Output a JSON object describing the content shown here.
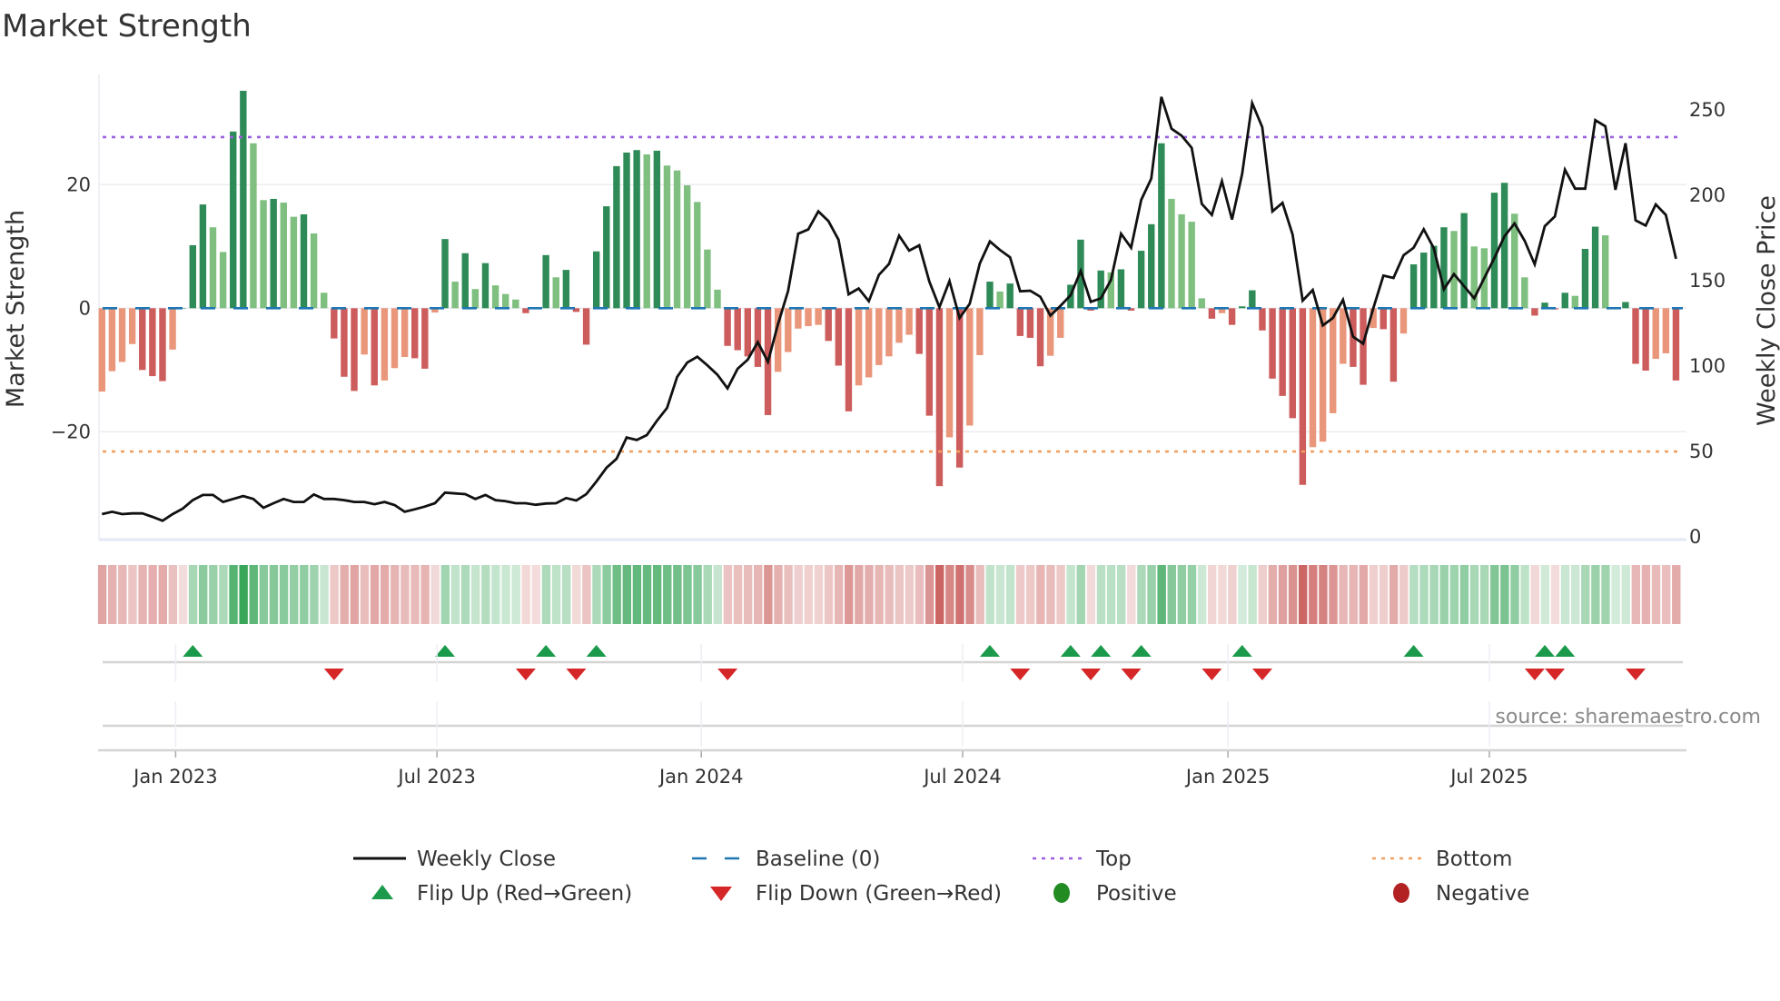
{
  "chart_data": {
    "type": "bar",
    "title": "Market Strength",
    "ylabel": "Market Strength",
    "y2label": "Weekly Close Price",
    "source": "source: sharemaestro.com",
    "ylim": [
      -37.5,
      38.5
    ],
    "y2lim": [
      0,
      260
    ],
    "yticks": [
      {
        "value": -20,
        "label": "−20"
      },
      {
        "value": 0,
        "label": "0"
      },
      {
        "value": 20,
        "label": "20"
      }
    ],
    "y2ticks": [
      {
        "value": 0,
        "label": "0"
      },
      {
        "value": 50,
        "label": "50"
      },
      {
        "value": 100,
        "label": "100"
      },
      {
        "value": 150,
        "label": "150"
      },
      {
        "value": 200,
        "label": "200"
      },
      {
        "value": 250,
        "label": "250"
      }
    ],
    "xticks": [
      {
        "week": 7.3,
        "label": "Jan 2023"
      },
      {
        "week": 33.2,
        "label": "Jul 2023"
      },
      {
        "week": 59.4,
        "label": "Jan 2024"
      },
      {
        "week": 85.3,
        "label": "Jul 2024"
      },
      {
        "week": 111.6,
        "label": "Jan 2025"
      },
      {
        "week": 137.5,
        "label": "Jul 2025"
      }
    ],
    "top_level": 27.7,
    "bottom_level": -23.2,
    "baseline": 0,
    "strength": [
      -13.5,
      -10.2,
      -8.7,
      -5.8,
      -10,
      -11,
      -11.8,
      -6.7,
      0,
      10.2,
      16.8,
      13.1,
      9.1,
      28.6,
      35.2,
      26.7,
      17.5,
      17.7,
      17.1,
      14.8,
      15.2,
      12.1,
      2.5,
      -4.9,
      -11.1,
      -13.4,
      -7.5,
      -12.5,
      -11.7,
      -9.7,
      -7.9,
      -8.1,
      -9.8,
      -0.7,
      11.2,
      4.3,
      8.9,
      3.1,
      7.3,
      3.7,
      2.3,
      1.4,
      -0.8,
      -0.1,
      8.6,
      5.0,
      6.2,
      -0.6,
      -5.9,
      9.2,
      16.5,
      23,
      25.2,
      25.6,
      24.9,
      25.5,
      23.1,
      22.3,
      19.9,
      17.2,
      9.5,
      3,
      -6.1,
      -6.8,
      -7.8,
      -9.5,
      -17.3,
      -10.3,
      -7.1,
      -3.3,
      -2.9,
      -2.7,
      -5.3,
      -9.3,
      -16.7,
      -12.5,
      -11.2,
      -9.2,
      -7.8,
      -5.6,
      -4.3,
      -7.4,
      -17.4,
      -28.8,
      -20.9,
      -25.8,
      -19,
      -7.6,
      4.3,
      2.7,
      4,
      -4.5,
      -4.8,
      -9.4,
      -7.7,
      -4.8,
      3.8,
      11.1,
      -0.4,
      6.1,
      5.8,
      6.3,
      -0.4,
      9.3,
      13.6,
      26.7,
      17.7,
      15.2,
      14,
      1.6,
      -1.7,
      -0.8,
      -2.7,
      0.3,
      2.9,
      -3.6,
      -11.4,
      -14.2,
      -17.8,
      -28.6,
      -22.5,
      -21.6,
      -17,
      -9,
      -9.5,
      -12.4,
      -3.2,
      -3.4,
      -11.9,
      -4.1,
      7.1,
      9,
      10.1,
      13.1,
      12.5,
      15.4,
      10,
      9.7,
      18.7,
      20.3,
      15.3,
      5,
      -1.2,
      0.9,
      -0.2,
      2.5,
      2,
      9.6,
      13.2,
      11.8,
      0.2,
      1,
      -9,
      -10.1,
      -8.2,
      -7.3,
      -11.7
    ],
    "weekly_close": [
      13.3,
      14.7,
      13.3,
      13.7,
      13.8,
      11.7,
      9.4,
      13.3,
      16.5,
      21.5,
      24.5,
      24.5,
      20.4,
      22.2,
      23.9,
      22.2,
      17,
      19.7,
      22.2,
      20.4,
      20.4,
      24.8,
      22.2,
      22.2,
      21.5,
      20.4,
      20.4,
      19.1,
      20.4,
      18.6,
      14.7,
      16.1,
      17.7,
      19.7,
      25.9,
      25.4,
      25,
      22.2,
      24.5,
      21.5,
      20.9,
      19.7,
      19.7,
      18.8,
      19.5,
      19.7,
      22.7,
      21.3,
      25,
      32.4,
      40.4,
      45.7,
      58.2,
      56.7,
      59.6,
      67.9,
      75.5,
      93.6,
      102,
      105.5,
      100.4,
      94.9,
      86.9,
      98.4,
      103.7,
      114,
      102.5,
      124.6,
      144,
      177.5,
      180,
      190.6,
      184.9,
      174,
      142,
      145.4,
      138,
      153.4,
      159.8,
      176.4,
      167.6,
      170.7,
      149.5,
      134.4,
      149.8,
      128.2,
      136.5,
      160.1,
      173,
      168,
      163.7,
      143.8,
      144.1,
      140.6,
      129.6,
      135.3,
      141.5,
      155.7,
      137.6,
      139.7,
      150.4,
      177.5,
      169.3,
      197.3,
      209.8,
      257.6,
      239,
      234.9,
      227.8,
      195,
      188.5,
      208.3,
      185.8,
      212.4,
      254,
      239.9,
      190.6,
      195.6,
      177,
      138.3,
      144.5,
      123.8,
      128.2,
      138.8,
      117.2,
      113.1,
      133.9,
      153,
      151.6,
      164.9,
      169.3,
      180.1,
      169,
      145,
      153.9,
      146.8,
      139.7,
      151.6,
      163.3,
      176,
      183.5,
      173.4,
      159.6,
      181.9,
      187.6,
      215,
      203.9,
      203.9,
      244,
      240.4,
      203.2,
      230.5,
      185.3,
      182.3,
      194.7,
      188.5,
      162.8
    ],
    "flip_up_weeks": [
      9,
      34,
      44,
      49,
      88,
      96,
      99,
      103,
      113,
      130,
      143,
      145
    ],
    "flip_down_weeks": [
      23,
      42,
      47,
      62,
      91,
      98,
      102,
      110,
      115,
      142,
      144,
      152
    ],
    "colors": {
      "rising_green": "#2e8b57",
      "falling_green": "#7fbf7f",
      "falling_red": "#cd5c5c",
      "rising_red": "#e9967a",
      "baseline": "#1f77b4",
      "top": "#9b5fe0",
      "bottom": "#f0a060",
      "close": "#111111",
      "flip_up": "#1a9a4a",
      "flip_down": "#d62728",
      "positive": "#228b22",
      "negative": "#b22222"
    },
    "legend": [
      {
        "label": "Weekly Close",
        "kind": "line-solid"
      },
      {
        "label": "Baseline (0)",
        "kind": "line-dashed"
      },
      {
        "label": "Top",
        "kind": "line-dotted-top"
      },
      {
        "label": "Bottom",
        "kind": "line-dotted-bottom"
      },
      {
        "label": "Flip Up (Red→Green)",
        "kind": "tri-up"
      },
      {
        "label": "Flip Down (Green→Red)",
        "kind": "tri-down"
      },
      {
        "label": "Positive",
        "kind": "dot-pos"
      },
      {
        "label": "Negative",
        "kind": "dot-neg"
      }
    ],
    "legend_placement": "bottom"
  }
}
